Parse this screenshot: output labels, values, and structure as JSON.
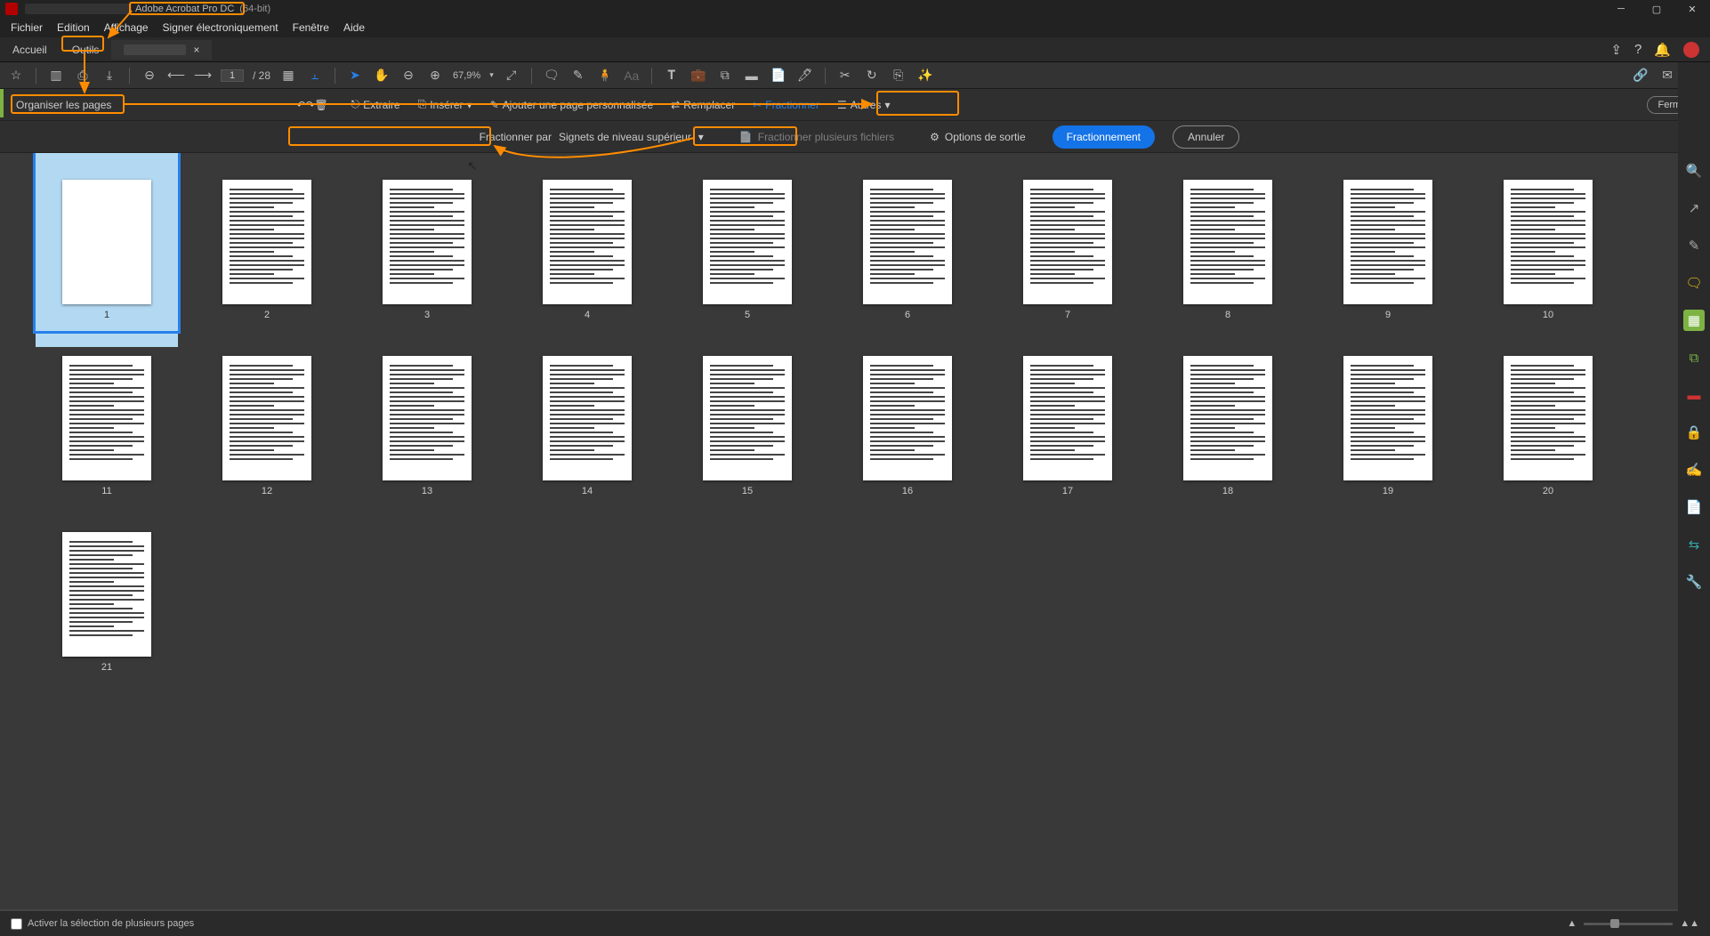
{
  "title": {
    "app": "Adobe Acrobat Pro DC",
    "suffix": "(64-bit)"
  },
  "menu": {
    "fichier": "Fichier",
    "edition": "Edition",
    "affichage": "Affichage",
    "signer": "Signer électroniquement",
    "fenetre": "Fenêtre",
    "aide": "Aide"
  },
  "tabs": {
    "home": "Accueil",
    "tools": "Outils",
    "close": "×"
  },
  "tool": {
    "page": "1",
    "totalpages": "/ 28",
    "zoom": "67,9%"
  },
  "ctx": {
    "organiser": "Organiser les pages",
    "extraire": "Extraire",
    "inserer": "Insérer",
    "ajouter": "Ajouter une page personnalisée",
    "remplacer": "Remplacer",
    "fractionner": "Fractionner",
    "autres": "Autres",
    "fermer": "Fermer"
  },
  "split": {
    "label": "Fractionner par",
    "value": "Signets de niveau supérieur",
    "multiple": "Fractionner plusieurs fichiers",
    "output": "Options de sortie",
    "go": "Fractionnement",
    "cancel": "Annuler"
  },
  "bottom": {
    "multi": "Activer la sélection de plusieurs pages"
  },
  "pages": [
    1,
    2,
    3,
    4,
    5,
    6,
    7,
    8,
    9,
    10,
    11,
    12,
    13,
    14,
    15,
    16,
    17,
    18,
    19,
    20,
    21
  ]
}
